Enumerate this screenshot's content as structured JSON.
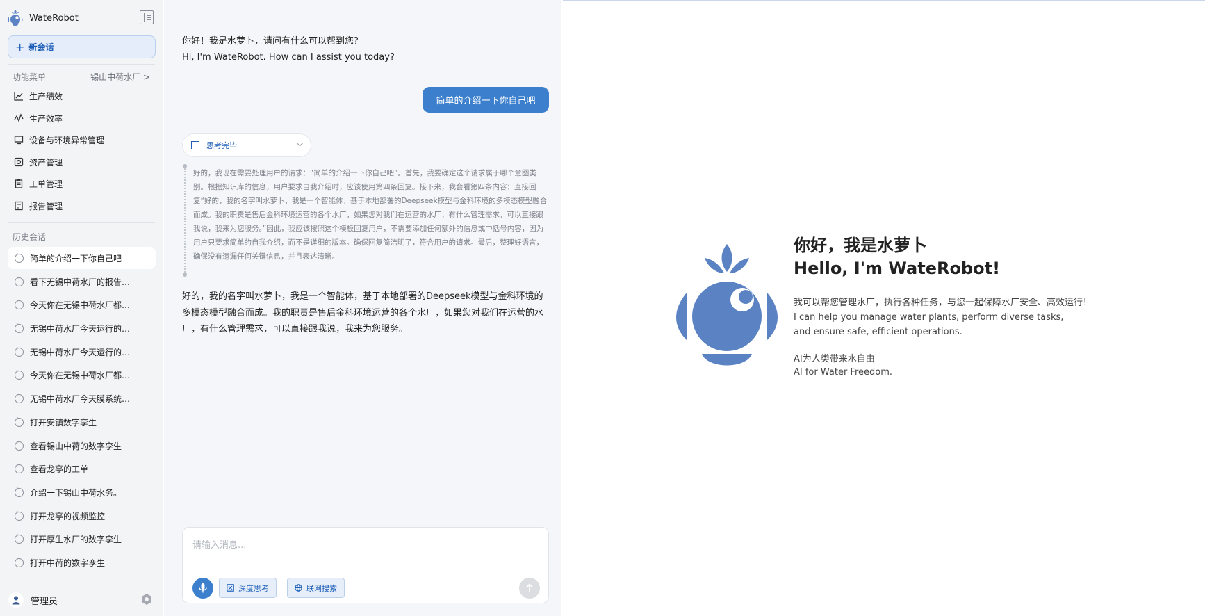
{
  "app": {
    "name": "WateRobot"
  },
  "sidebar": {
    "new_chat_label": "新会话",
    "menu_section_label": "功能菜单",
    "plant_selector": "锡山中荷水厂 >",
    "menu_items": [
      {
        "label": "生产绩效",
        "icon": "chart-line-icon"
      },
      {
        "label": "生产效率",
        "icon": "pulse-icon"
      },
      {
        "label": "设备与环境异常管理",
        "icon": "monitor-icon"
      },
      {
        "label": "资产管理",
        "icon": "asset-icon"
      },
      {
        "label": "工单管理",
        "icon": "clipboard-icon"
      },
      {
        "label": "报告管理",
        "icon": "report-icon"
      }
    ],
    "history_section_label": "历史会话",
    "history_items": [
      "简单的介绍一下你自己吧",
      "看下无锡中荷水厂的报告…",
      "今天你在无锡中荷水厂都…",
      "无锡中荷水厂今天运行的…",
      "无锡中荷水厂今天运行的…",
      "今天你在无锡中荷水厂都…",
      "无锡中荷水厂今天膜系统…",
      "打开安镇数字孪生",
      "查看锡山中荷的数字孪生",
      "查看龙亭的工单",
      "介绍一下锡山中荷水务。",
      "打开龙亭的视频监控",
      "打开厚生水厂的数字孪生",
      "打开中荷的数字孪生"
    ],
    "user_name": "管理员"
  },
  "chat": {
    "greeting_zh": "你好！我是水萝卜，请问有什么可以帮到您？",
    "greeting_en": "Hi, I'm WateRobot. How can I assist you today?",
    "user_message": "简单的介绍一下你自己吧",
    "think_label": "思考完毕",
    "think_text": "好的，我现在需要处理用户的请求：“简单的介绍一下你自己吧”。首先，我要确定这个请求属于哪个意图类别。根据知识库的信息，用户要求自我介绍时，应该使用第四条回复。接下来，我会看第四条内容：直接回复“好的，我的名字叫水萝卜，我是一个智能体，基于本地部署的Deepseek模型与金科环境的多模态模型融合而成。我的职责是售后金科环境运营的各个水厂，如果您对我们在运营的水厂，有什么管理需求，可以直接跟我说，我来为您服务。”因此，我应该按照这个模板回复用户，不需要添加任何额外的信息或中括号内容，因为用户只要求简单的自我介绍，而不是详细的版本。确保回复简洁明了，符合用户的请求。最后，整理好语言，确保没有遗漏任何关键信息，并且表达清晰。",
    "answer": "好的，我的名字叫水萝卜，我是一个智能体，基于本地部署的Deepseek模型与金科环境的多模态模型融合而成。我的职责是售后金科环境运营的各个水厂，如果您对我们在运营的水厂，有什么管理需求，可以直接跟我说，我来为您服务。",
    "input_placeholder": "请输入消息...",
    "deep_think_label": "深度思考",
    "web_search_label": "联网搜索"
  },
  "welcome": {
    "title_zh": "你好，我是水萝卜",
    "title_en": "Hello, I'm WateRobot!",
    "desc_zh": "我可以帮您管理水厂，执行各种任务，与您一起保障水厂安全、高效运行！",
    "desc_en_1": "I can help you manage water plants, perform diverse tasks,",
    "desc_en_2": "and ensure safe, efficient operations.",
    "slogan_zh": "AI为人类带来水自由",
    "slogan_en": "AI for Water Freedom."
  },
  "colors": {
    "accent": "#3b7fcd",
    "logo": "#5b83c4",
    "sidebar_bg": "#f3f4f6"
  }
}
